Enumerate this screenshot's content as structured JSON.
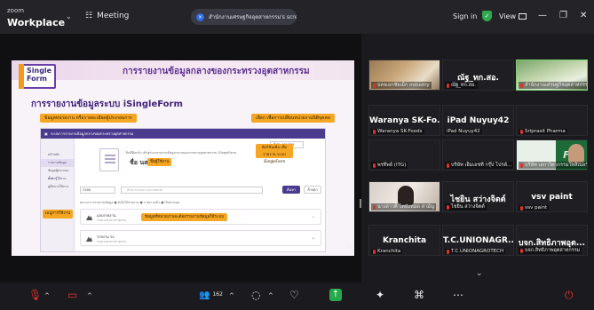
{
  "titlebar": {
    "brand_small": "zoom",
    "brand_big": "Workplace",
    "meeting_label": "Meeting",
    "share_text": "สำนักงานเศรษฐกิจอุตสาหกรรม's scre",
    "sign_in": "Sign in",
    "view": "View"
  },
  "slide": {
    "logo_line1": "Single",
    "logo_line2": "Form",
    "header_title": "การรายงานข้อมูลกลางของกระทรวงอุตสาหกรรม",
    "subtitle": "การรายงานข้อมูลระบบ iSingleForm",
    "tag_left": "ข้อมูลหน่วยงาน หรือรายละเอียดผู้ประกอบการ",
    "tag_right": "เลือก เพื่อการเปลี่ยนหน่วยงานนิติบุคคล",
    "shot_header": "ระบบการรายงานข้อมูลกลางของกระทรวงอุตสาหกรรม",
    "side_items": [
      "หน้าหลัก",
      "รายงานข้อมูล",
      "ข้อมูลผู้ประกอบการ",
      "ตั้งค่าผู้ใช้งาน",
      "คู่มือการใช้งาน"
    ],
    "tag_side": "เมนูการใช้งาน",
    "card_desc": "ยินดีต้อนรับ เข้าสู่ระบบรายงานข้อมูลกลางของกระทรวงอุตสาหกรรม iSingleForm",
    "card_name": "ชื่อ   นส",
    "tag_name": "ชื่อผู้ใช้งาน",
    "tag_feature": "ฟังก์ชันเพิ่ม เพื่อรายงาน ระบบ iSingleForm",
    "dropdown": "ผู้ประกอบการ",
    "filter_year": "2568",
    "filter_search": "ค้นหาหน่วยงาน/แบบฟอร์ม",
    "btn_search": "ค้นหา",
    "btn_reset": "ล้างค่า",
    "legend": "สถานะการรายงานข้อมูล  ● ยังไม่ได้รายงาน  ● รายงานแล้ว  ● เกินกำหนด",
    "rows": [
      {
        "name": "แบบรายงาน",
        "date": "ระยะเวลาการรายงาน",
        "tag": "ข้อมูลที่หน่วยงานจะต้องรายงานข้อมูลให้ระบบ"
      },
      {
        "name": "รายงาน รง.",
        "date": "ระยะเวลาการรายงาน",
        "tag": ""
      }
    ],
    "page_number": "11"
  },
  "gallery": [
    {
      "name": "",
      "label": "บลจเอกชัยเม็ก industry",
      "style": "photo1"
    },
    {
      "name": "ณัฐ_ทก.สอ.",
      "label": "ณัฐ_ทก.สอ.",
      "style": "plain"
    },
    {
      "name": "",
      "label": "สำนักงานเศรษฐกิจอุตสาหกรรม",
      "style": "photo2"
    },
    {
      "name": "Waranya SK-Fo...",
      "label": "Waranya SK-Foods",
      "style": "plain"
    },
    {
      "name": "iPad Nuyuy42",
      "label": "iPad Nuyuy42",
      "style": "plain"
    },
    {
      "name": "",
      "label": "Sriprasit Pharma",
      "style": "plain"
    },
    {
      "name": "",
      "label": "พรทิพย์ (ITG)",
      "style": "plain"
    },
    {
      "name": "",
      "label": "บริษัท เอ็มเอชที กรุ๊ป โปรดั...",
      "style": "plain"
    },
    {
      "name": "",
      "label": "บริษัท เอกาวิศวกรรมโพลิเมอร์",
      "style": "fwa"
    },
    {
      "name": "",
      "label": "นางสาวศิ โทบังหมด สามัญ",
      "style": "photo4"
    },
    {
      "name": "ไชยิน สว่างจิตต์",
      "label": "ไชยิน สว่างจิตต์",
      "style": "plain"
    },
    {
      "name": "vsv paint",
      "label": "vsv paint",
      "style": "plain"
    },
    {
      "name": "Kranchita",
      "label": "Kranchita",
      "style": "plain"
    },
    {
      "name": "T.C.UNIONAGR...",
      "label": "T.C.UNIONAGROTECH",
      "style": "plain"
    },
    {
      "name": "บจก.สิทธิภาพอุต...",
      "label": "บจก.สิทธิภาพอุตสาหกรรม",
      "style": "plain"
    }
  ],
  "toolbar": {
    "participants": "162"
  }
}
